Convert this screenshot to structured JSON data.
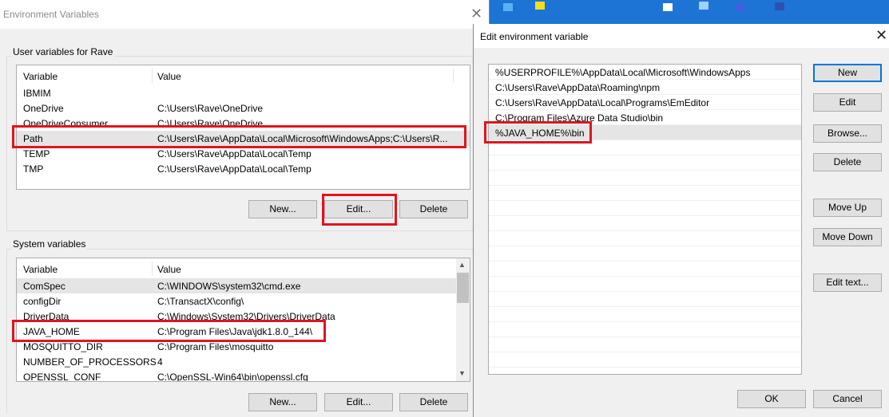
{
  "env_window": {
    "title": "Environment Variables",
    "user_group": "User variables for Rave",
    "col_variable": "Variable",
    "col_value": "Value",
    "user_rows": [
      {
        "name": "IBMIM",
        "value": ""
      },
      {
        "name": "OneDrive",
        "value": "C:\\Users\\Rave\\OneDrive"
      },
      {
        "name": "OneDriveConsumer",
        "value": "C:\\Users\\Rave\\OneDrive"
      },
      {
        "name": "Path",
        "value": "C:\\Users\\Rave\\AppData\\Local\\Microsoft\\WindowsApps;C:\\Users\\R..."
      },
      {
        "name": "TEMP",
        "value": "C:\\Users\\Rave\\AppData\\Local\\Temp"
      },
      {
        "name": "TMP",
        "value": "C:\\Users\\Rave\\AppData\\Local\\Temp"
      }
    ],
    "user_buttons": {
      "new": "New...",
      "edit": "Edit...",
      "delete": "Delete"
    },
    "system_group": "System variables",
    "system_rows": [
      {
        "name": "ComSpec",
        "value": "C:\\WINDOWS\\system32\\cmd.exe"
      },
      {
        "name": "configDir",
        "value": "C:\\TransactX\\config\\"
      },
      {
        "name": "DriverData",
        "value": "C:\\Windows\\System32\\Drivers\\DriverData"
      },
      {
        "name": "JAVA_HOME",
        "value": "C:\\Program Files\\Java\\jdk1.8.0_144\\"
      },
      {
        "name": "MOSQUITTO_DIR",
        "value": "C:\\Program Files\\mosquitto"
      },
      {
        "name": "NUMBER_OF_PROCESSORS",
        "value": "4"
      },
      {
        "name": "OPENSSL_CONF",
        "value": "C:\\OpenSSL-Win64\\bin\\openssl.cfg"
      }
    ],
    "system_buttons": {
      "new": "New...",
      "edit": "Edit...",
      "delete": "Delete"
    }
  },
  "edit_dialog": {
    "title": "Edit environment variable",
    "entries": [
      "%USERPROFILE%\\AppData\\Local\\Microsoft\\WindowsApps",
      "C:\\Users\\Rave\\AppData\\Roaming\\npm",
      "C:\\Users\\Rave\\AppData\\Local\\Programs\\EmEditor",
      "C:\\Program Files\\Azure Data Studio\\bin",
      "%JAVA_HOME%\\bin"
    ],
    "buttons": {
      "new": "New",
      "edit": "Edit",
      "browse": "Browse...",
      "delete": "Delete",
      "move_up": "Move Up",
      "move_down": "Move Down",
      "edit_text": "Edit text...",
      "ok": "OK",
      "cancel": "Cancel"
    }
  },
  "colors": {
    "highlight": "#e0141e",
    "accent": "#0078d7"
  }
}
